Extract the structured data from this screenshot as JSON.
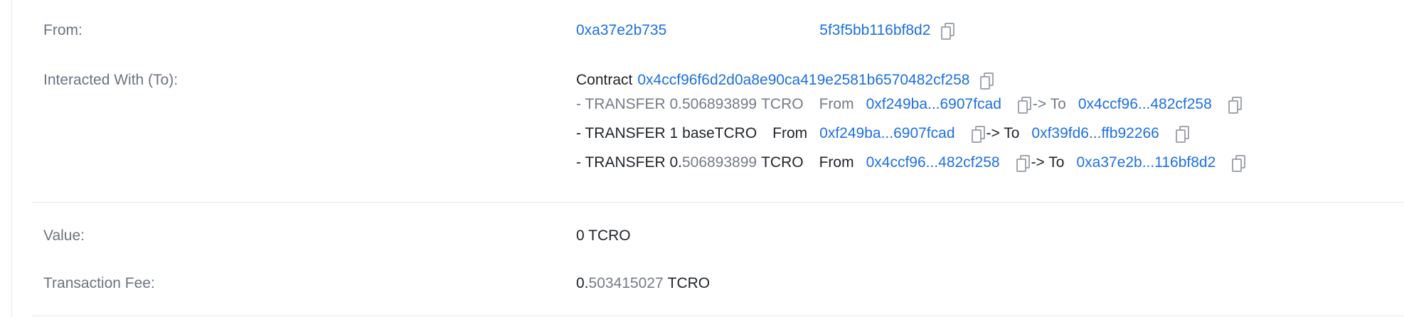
{
  "rows": {
    "from": {
      "label": "From:",
      "address_part1": "0xa37e2b735",
      "address_part2": "5f3f5bb116bf8d2"
    },
    "interacted": {
      "label": "Interacted With (To):",
      "contract_prefix": "Contract",
      "contract_address": "0x4ccf96f6d2d0a8e90ca419e2581b6570482cf258",
      "transfers": [
        {
          "prefix": "- TRANSFER 0.",
          "amount_fraction": "506893899",
          "token": "TCRO",
          "from_label": "From",
          "from_address": "0xf249ba...6907fcad",
          "arrow_to": "-> To",
          "to_address": "0x4ccf96...482cf258"
        },
        {
          "prefix": "- TRANSFER 1",
          "amount_fraction": "",
          "token": "baseTCRO",
          "from_label": "From",
          "from_address": "0xf249ba...6907fcad",
          "arrow_to": "-> To",
          "to_address": "0xf39fd6...ffb92266"
        },
        {
          "prefix": "- TRANSFER 0.",
          "amount_fraction": "506893899",
          "token": "TCRO",
          "from_label": "From",
          "from_address": "0x4ccf96...482cf258",
          "arrow_to": "-> To",
          "to_address": "0xa37e2b...116bf8d2"
        }
      ]
    },
    "value": {
      "label": "Value:",
      "amount": "0 TCRO"
    },
    "fee": {
      "label": "Transaction Fee:",
      "whole": "0.",
      "fraction": "503415027",
      "token": "TCRO"
    }
  },
  "colors": {
    "link": "#1d6fe0",
    "label": "#6c737f",
    "text": "#1f2328",
    "muted": "#757b85",
    "divider": "#e6e8eb"
  }
}
